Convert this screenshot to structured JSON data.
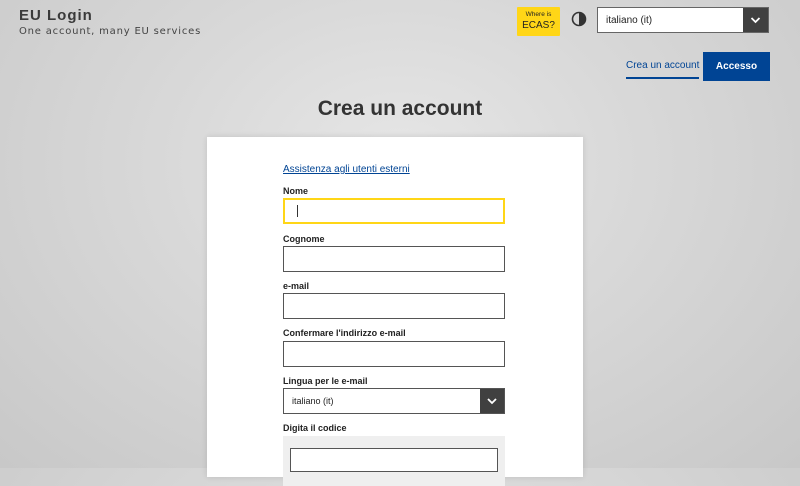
{
  "header": {
    "brand_title": "EU Login",
    "brand_tagline": "One account, many EU services",
    "ecas_badge": {
      "line1": "Where is",
      "line2": "ECAS?",
      "color": "#ffd617"
    },
    "contrast_icon": "contrast-icon",
    "language_select": {
      "value": "italiano (it)",
      "icon": "chevron-down-icon"
    }
  },
  "nav": {
    "create_account": "Crea un account",
    "login": "Accesso",
    "accent_color": "#004494"
  },
  "page_title": "Crea un account",
  "form": {
    "support_link": "Assistenza agli utenti esterni",
    "fields": [
      {
        "label": "Nome",
        "value": "",
        "focused": true
      },
      {
        "label": "Cognome",
        "value": ""
      },
      {
        "label": "e-mail",
        "value": ""
      },
      {
        "label": "Confermare l'indirizzo e-mail",
        "value": ""
      }
    ],
    "email_language": {
      "label": "Lingua per le e-mail",
      "value": "italiano (it)"
    },
    "captcha": {
      "label": "Digita il codice"
    }
  }
}
